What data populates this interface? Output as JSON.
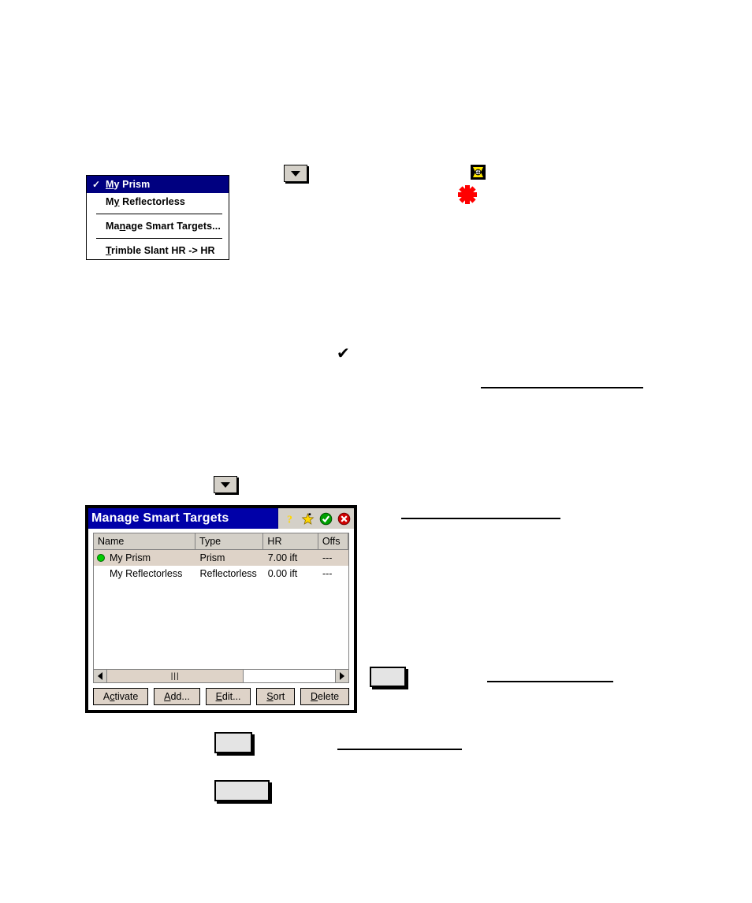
{
  "target_menu": {
    "items": [
      {
        "label": "My Prism",
        "accel_index": 0,
        "checked": true,
        "selected": true,
        "separator_after": false
      },
      {
        "label": "My Reflectorless",
        "accel_index": 1,
        "checked": false,
        "selected": false,
        "separator_after": true
      },
      {
        "label": "Manage Smart Targets...",
        "accel_index": 2,
        "checked": false,
        "selected": false,
        "separator_after": true
      },
      {
        "label": "Trimble Slant HR -> HR",
        "accel_index": 0,
        "checked": false,
        "selected": false,
        "separator_after": false
      }
    ],
    "check_glyph": "✓"
  },
  "dropdown_buttons": {
    "button_1_name": "target-dropdown-button",
    "button_2_name": "smart-targets-dropdown-button"
  },
  "icons": {
    "prism_target": "prism-target-icon",
    "red_asterisk": "red-asterisk-icon",
    "inline_check": "✔"
  },
  "dialog": {
    "title": "Manage Smart Targets",
    "titlebar_icons": [
      {
        "name": "help-icon",
        "glyph": "?"
      },
      {
        "name": "favorites-star-icon",
        "glyph": "★"
      },
      {
        "name": "ok-check-icon",
        "glyph": "✔"
      },
      {
        "name": "close-icon",
        "glyph": "✕"
      }
    ],
    "table": {
      "columns": [
        "Name",
        "Type",
        "HR",
        "Offs"
      ],
      "rows": [
        {
          "active": true,
          "name": "My Prism",
          "type": "Prism",
          "hr": "7.00 ift",
          "offset": "---"
        },
        {
          "active": false,
          "name": "My Reflectorless",
          "type": "Reflectorless",
          "hr": "0.00 ift",
          "offset": "---"
        }
      ]
    },
    "scrollbar": {
      "left_arrow": "◄",
      "right_arrow": "►",
      "grip": "|||"
    },
    "buttons": [
      {
        "label": "Activate",
        "accel_index": 1
      },
      {
        "label": "Add...",
        "accel_index": 0
      },
      {
        "label": "Edit...",
        "accel_index": 0
      },
      {
        "label": "Sort",
        "accel_index": 0
      },
      {
        "label": "Delete",
        "accel_index": 0
      }
    ]
  },
  "colors": {
    "menu_highlight": "#000080",
    "dialog_titlebar": "#0000a8",
    "row_selected": "#ded3c8",
    "button_face": "#ded3c8",
    "active_dot": "#00cc00",
    "asterisk": "#ff0000"
  }
}
